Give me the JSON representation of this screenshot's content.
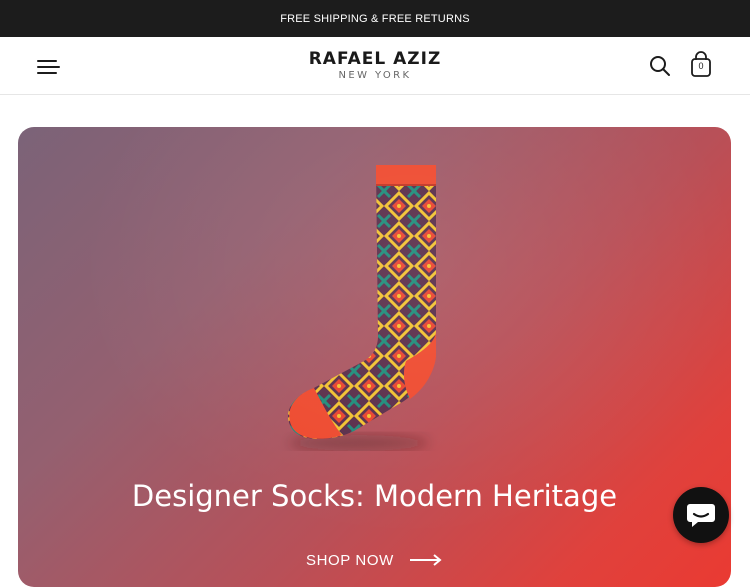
{
  "announcement": {
    "text": "FREE SHIPPING & FREE RETURNS"
  },
  "header": {
    "brand_name": "RAFAEL AZIZ",
    "brand_location": "NEW YORK",
    "cart_count": "0",
    "icons": {
      "menu": "hamburger-menu-icon",
      "search": "search-icon",
      "cart": "shopping-bag-icon"
    }
  },
  "hero": {
    "title": "Designer Socks: Modern Heritage",
    "cta_label": "SHOP NOW",
    "image": "patterned-sock",
    "colors": {
      "gradient_start": "#7b6378",
      "gradient_end": "#ea3a32"
    }
  },
  "chat": {
    "icon": "chat-bubble-icon"
  },
  "colors": {
    "topbar": "#1c1c1c",
    "text": "#1a1a1a"
  }
}
